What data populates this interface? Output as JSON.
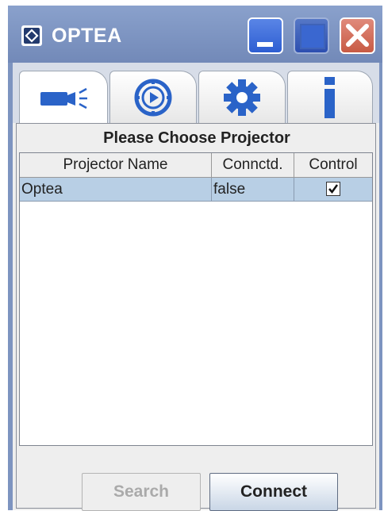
{
  "window": {
    "title": "OPTEA",
    "icon": "optea-logo-icon",
    "controls": [
      "minimize-icon",
      "maximize-icon",
      "close-icon"
    ]
  },
  "tabs": [
    {
      "icon": "projector-icon",
      "selected": true
    },
    {
      "icon": "play-circle-icon",
      "selected": false
    },
    {
      "icon": "gear-icon",
      "selected": false
    },
    {
      "icon": "info-icon",
      "selected": false
    }
  ],
  "panel": {
    "title": "Please Choose Projector"
  },
  "table": {
    "columns": [
      "Projector Name",
      "Connctd.",
      "Control"
    ],
    "rows": [
      {
        "name": "Optea",
        "connected": "false",
        "control": true,
        "selected": true
      }
    ]
  },
  "buttons": {
    "search_label": "Search",
    "search_enabled": false,
    "connect_label": "Connect"
  },
  "colors": {
    "titlebar": "#7d94c0",
    "selected_row": "#b8cfe5",
    "icon_blue": "#2a63c8"
  }
}
